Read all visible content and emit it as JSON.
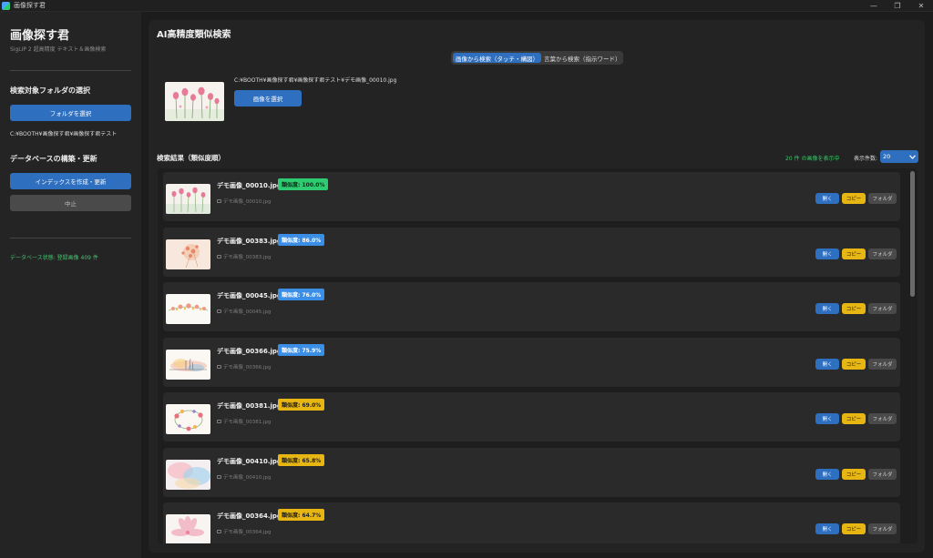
{
  "window": {
    "title": "画像探す君",
    "controls": [
      "—",
      "❐",
      "✕"
    ]
  },
  "sidebar": {
    "app_title": "画像探す君",
    "app_subtitle": "SigLIP 2 超高精度 テキスト＆画像検索",
    "folder_section_title": "検索対象フォルダの選択",
    "select_folder_button": "フォルダを選択",
    "folder_path": "C:¥BOOTH¥画像探す君¥画像探す君テスト",
    "db_section_title": "データベースの構築・更新",
    "build_index_button": "インデックスを作成・更新",
    "stop_button": "中止",
    "db_status": "データベース状態: 登録画像 409 件"
  },
  "main": {
    "title": "AI高精度類似検索",
    "tabs": [
      {
        "label": "画像から検索（タッチ・構図）",
        "active": true
      },
      {
        "label": "言葉から検索（指示ワード）",
        "active": false
      }
    ],
    "query_path": "C:¥BOOTH¥画像探す君¥画像探す君テスト¥デモ画像_00010.jpg",
    "select_image_button": "画像を選択",
    "results_label": "検索結果（類似度順）",
    "count_text": "20 件 の画像を表示中",
    "per_page_label": "表示件数:",
    "per_page_value": "20",
    "actions": {
      "open": "開く",
      "copy": "コピー",
      "folder": "フォルダ"
    },
    "scroll_fraction_visible": 0.34
  },
  "results": [
    {
      "filename": "デモ画像_00010.jpg",
      "similarity": "類似度: 100.0%",
      "level": "high",
      "subpath": "デモ画像_00010.jpg",
      "thumb": "pink-tulips"
    },
    {
      "filename": "デモ画像_00383.jpg",
      "similarity": "類似度: 86.0%",
      "level": "mid",
      "subpath": "デモ画像_00383.jpg",
      "thumb": "peach-blossom"
    },
    {
      "filename": "デモ画像_00045.jpg",
      "similarity": "類似度: 76.0%",
      "level": "mid",
      "subpath": "デモ画像_00045.jpg",
      "thumb": "floral-garland"
    },
    {
      "filename": "デモ画像_00366.jpg",
      "similarity": "類似度: 75.9%",
      "level": "mid",
      "subpath": "デモ画像_00366.jpg",
      "thumb": "watercolor-splash"
    },
    {
      "filename": "デモ画像_00381.jpg",
      "similarity": "類似度: 69.0%",
      "level": "low",
      "subpath": "デモ画像_00381.jpg",
      "thumb": "flower-wreath"
    },
    {
      "filename": "デモ画像_00410.jpg",
      "similarity": "類似度: 65.8%",
      "level": "low",
      "subpath": "デモ画像_00410.jpg",
      "thumb": "pastel-wash"
    },
    {
      "filename": "デモ画像_00364.jpg",
      "similarity": "類似度: 64.7%",
      "level": "low",
      "subpath": "デモ画像_00364.jpg",
      "thumb": "pink-lily"
    }
  ],
  "colors": {
    "accent_blue": "#2f6fbf",
    "badge_high": "#2ecc71",
    "badge_mid": "#3a8ee6",
    "badge_low": "#e8b613",
    "status_green": "#3fc46a"
  }
}
